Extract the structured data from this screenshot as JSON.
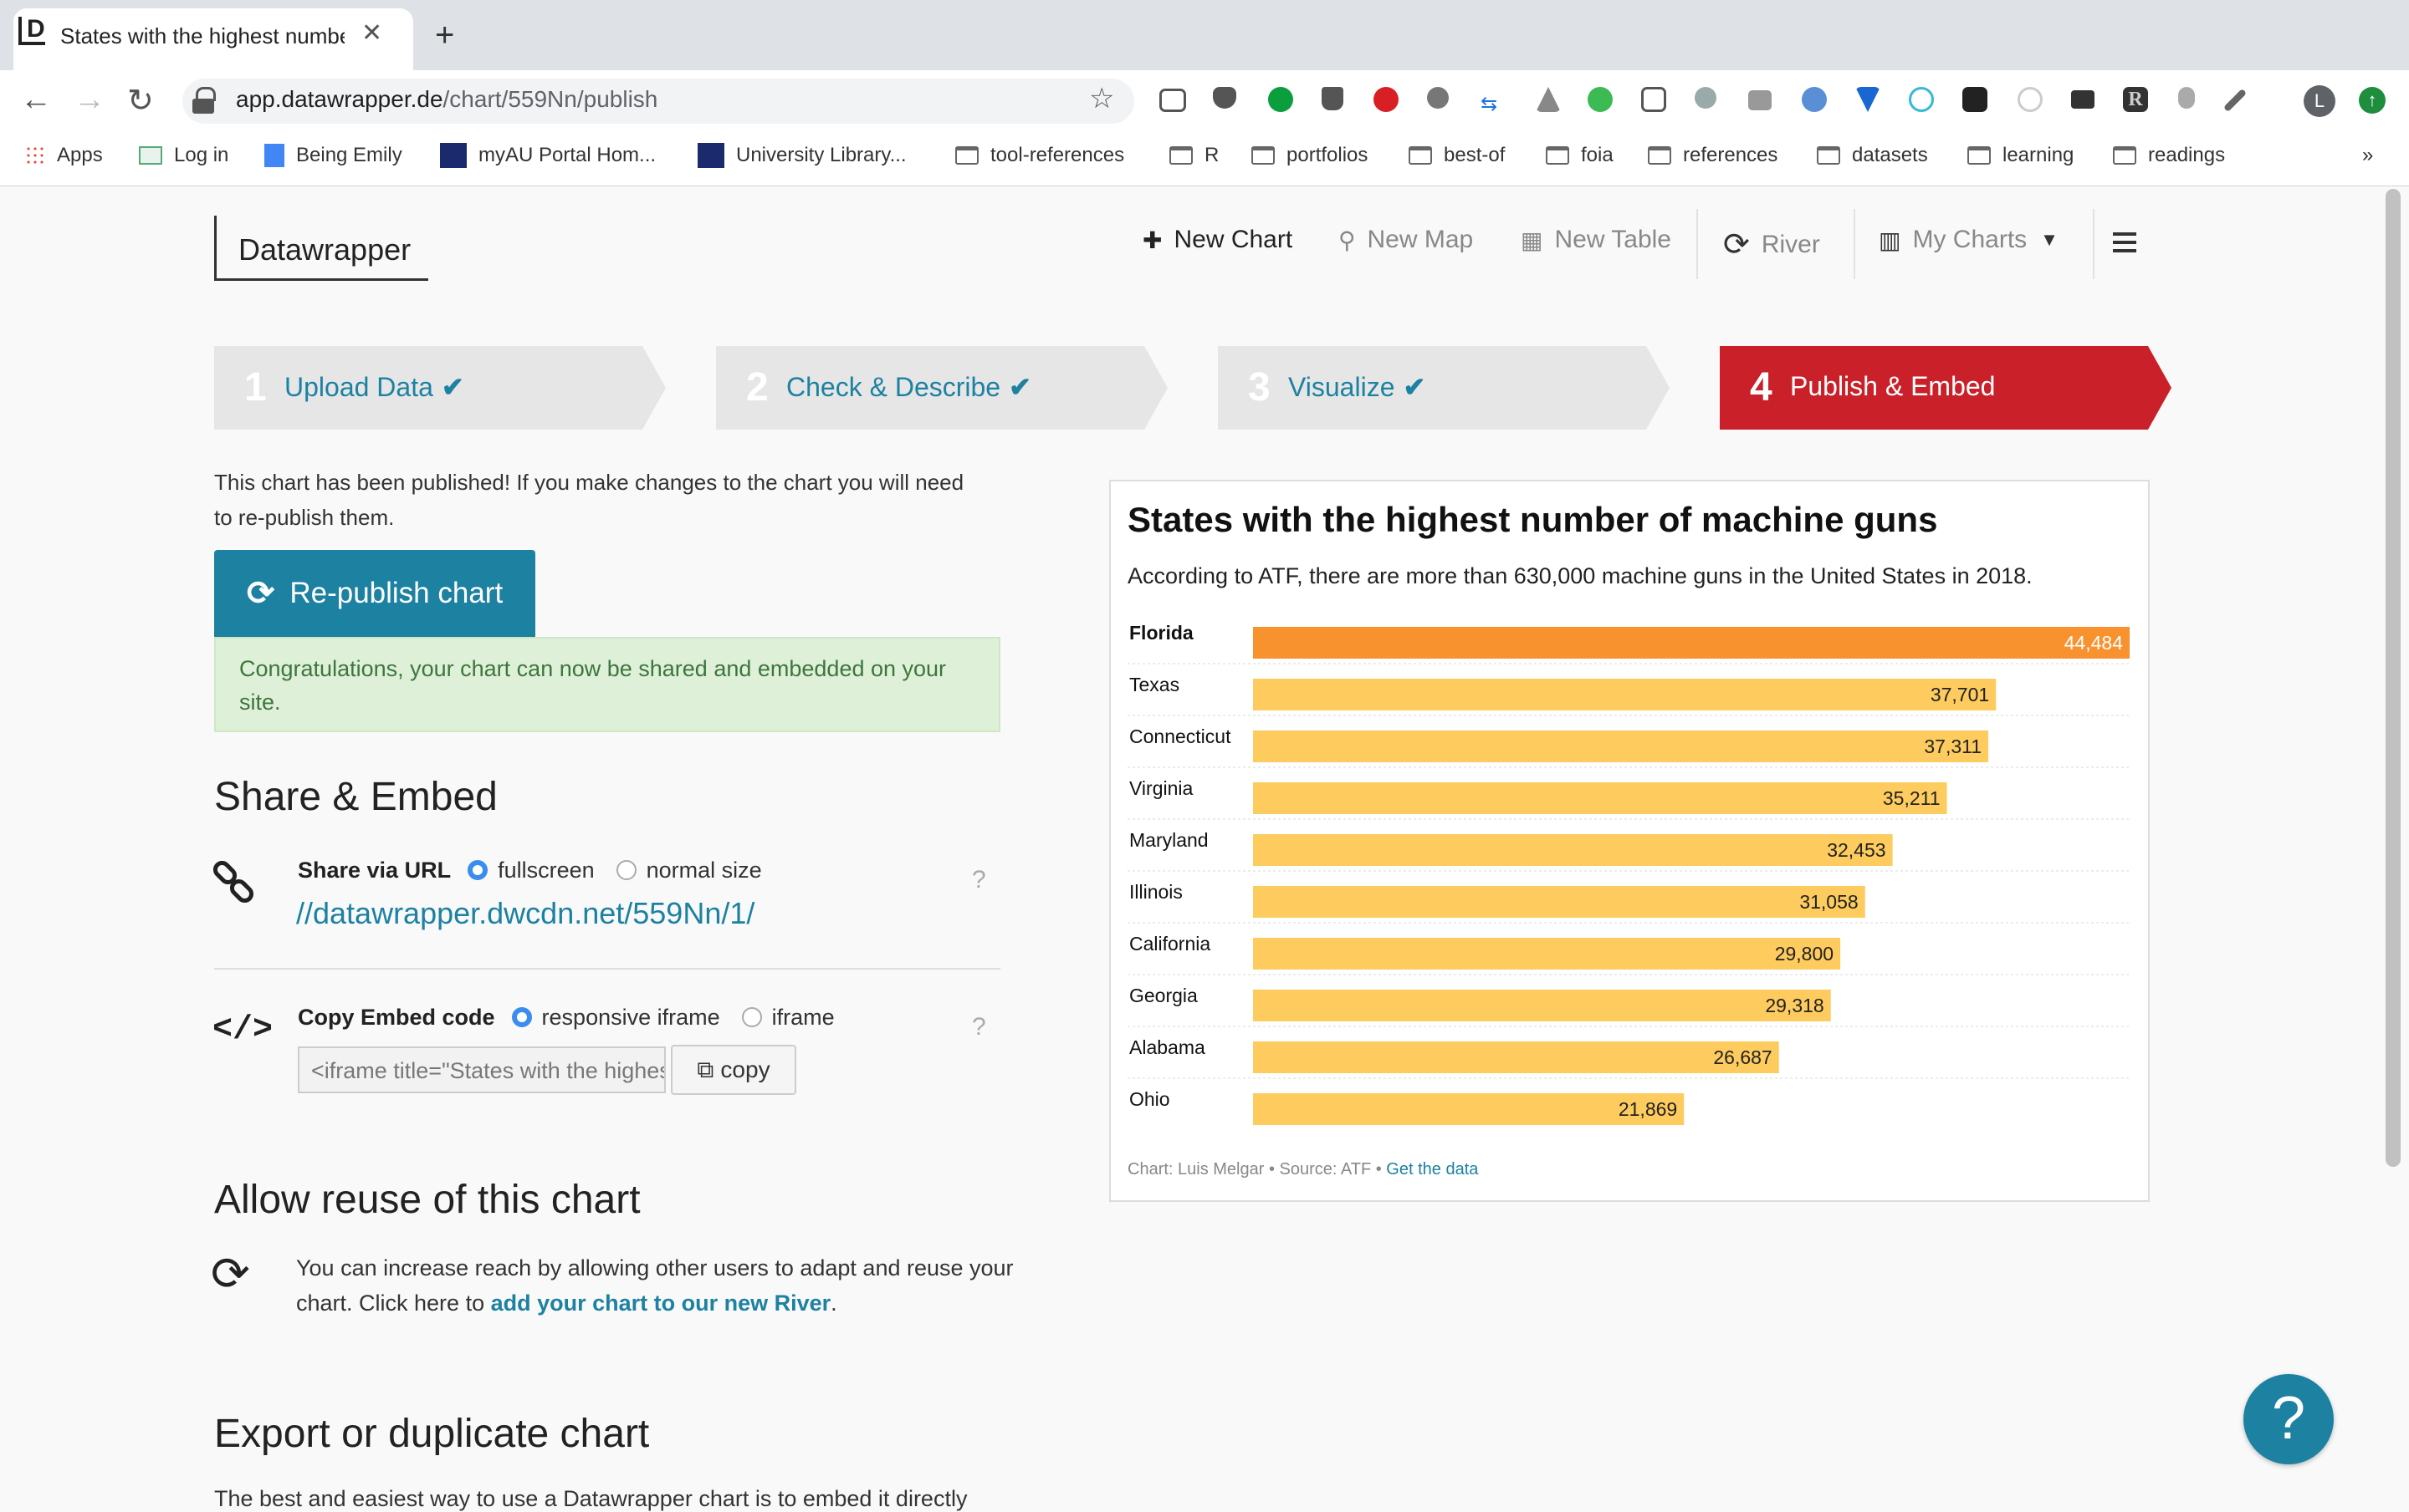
{
  "browser": {
    "tab_title": "States with the highest number of machine guns",
    "url_domain": "app.datawrapper.de",
    "url_path": "/chart/559Nn/publish",
    "profile_initial": "L",
    "bookmarks": [
      "Apps",
      "Log in",
      "Being Emily",
      "myAU Portal Hom...",
      "University Library...",
      "tool-references",
      "R",
      "portfolios",
      "best-of",
      "foia",
      "references",
      "datasets",
      "learning",
      "readings"
    ],
    "more": "»"
  },
  "app": {
    "logo": "Datawrapper",
    "nav": {
      "new_chart": "New Chart",
      "new_map": "New Map",
      "new_table": "New Table",
      "river": "River",
      "my_charts": "My Charts"
    },
    "steps": [
      {
        "num": "1",
        "label": "Upload Data",
        "done": true
      },
      {
        "num": "2",
        "label": "Check & Describe",
        "done": true
      },
      {
        "num": "3",
        "label": "Visualize",
        "done": true
      },
      {
        "num": "4",
        "label": "Publish & Embed",
        "done": false
      }
    ],
    "published_msg": "This chart has been published! If you make changes to the chart you will need to re-publish them.",
    "republish_label": "Re-publish chart",
    "alert_msg": "Congratulations, your chart can now be shared and embedded on your site.",
    "share_embed": {
      "heading": "Share & Embed",
      "share_label": "Share via URL",
      "opt_fullscreen": "fullscreen",
      "opt_normal": "normal size",
      "share_url": "//datawrapper.dwcdn.net/559Nn/1/",
      "embed_label": "Copy Embed code",
      "opt_responsive": "responsive iframe",
      "opt_iframe": "iframe",
      "embed_code": "<iframe title=\"States with the highest number of machine guns\"",
      "copy_label": "copy",
      "help": "?"
    },
    "reuse": {
      "heading": "Allow reuse of this chart",
      "text": "You can increase reach by allowing other users to adapt and reuse your chart. Click here to ",
      "link": "add your chart to our new River",
      "period": "."
    },
    "export_heading": "Export or duplicate chart",
    "export_text": "The best and easiest way to use a Datawrapper chart is to embed it directly",
    "help_button": "?"
  },
  "chart_data": {
    "type": "bar",
    "orientation": "horizontal",
    "title": "States with the highest number of machine guns",
    "subtitle": "According to ATF, there are more than 630,000 machine guns in the United States in 2018.",
    "categories": [
      "Florida",
      "Texas",
      "Connecticut",
      "Virginia",
      "Maryland",
      "Illinois",
      "California",
      "Georgia",
      "Alabama",
      "Ohio"
    ],
    "values": [
      44484,
      37701,
      37311,
      35211,
      32453,
      31058,
      29800,
      29318,
      26687,
      21869
    ],
    "value_labels": [
      "44,484",
      "37,701",
      "37,311",
      "35,211",
      "32,453",
      "31,058",
      "29,800",
      "29,318",
      "26,687",
      "21,869"
    ],
    "xlim": [
      0,
      44484
    ],
    "highlight_index": 0,
    "colors": {
      "highlight": "#f7922e",
      "default": "#fdcb5e"
    },
    "footer": {
      "byline": "Chart: Luis Melgar • Source: ATF • ",
      "link": "Get the data"
    }
  }
}
